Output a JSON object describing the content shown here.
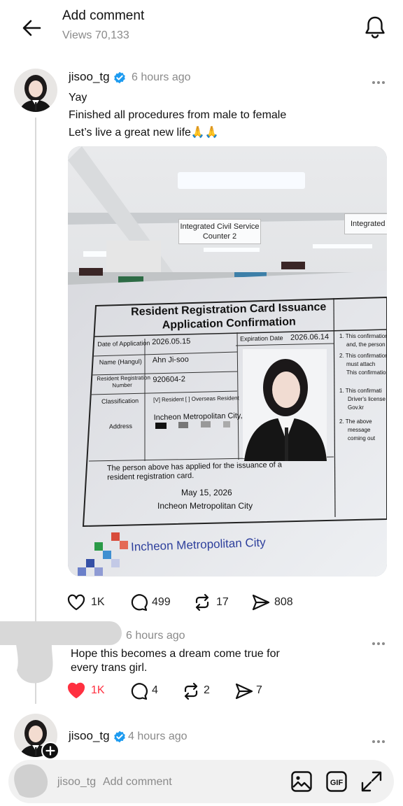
{
  "header": {
    "title": "Add comment",
    "views": "Views 70,133"
  },
  "post": {
    "username": "jisoo_tg",
    "time": "6 hours ago",
    "lines": [
      "Yay",
      "Finished all procedures from male to female",
      "Let’s live a great new life🙏🙏"
    ],
    "photo": {
      "sign_1": "Integrated Civil Service",
      "sign_1b": "Counter 2",
      "sign_2": "Integrated",
      "doc_title_1": "Resident Registration Card Issuance",
      "doc_title_2": "Application Confirmation",
      "date_label": "Date of Application",
      "date_value": "2026.05.15",
      "exp_label": "Expiration Date",
      "exp_value": "2026.06.14",
      "name_label": "Name (Hangul)",
      "name_value": "Ahn Ji-soo",
      "rrn_label_1": "Resident Registration",
      "rrn_label_2": "Number",
      "rrn_value": "920604-2",
      "class_label": "Classification",
      "class_value": "[V] Resident  [  ] Overseas Resident",
      "addr_label": "Address",
      "addr_value": "Incheon Metropolitan City,",
      "side_1": "1. This confirmation",
      "side_1b": "and, the person",
      "side_2": "2. This confirmation",
      "side_2b": "must attach",
      "side_2c": "This confirmation",
      "side_3": "1. This confirmati",
      "side_3b": "Driver's license",
      "side_3c": "Gov.kr",
      "side_4": "2. The above",
      "side_4b": "message",
      "side_4c": "coming out",
      "statement_1": "The person above has applied for the issuance of a",
      "statement_2": "resident registration card.",
      "issue_date": "May 15, 2026",
      "issuer": "Incheon Metropolitan City",
      "logo_text": "Incheon Metropolitan City"
    },
    "actions": {
      "likes": "1K",
      "comments": "499",
      "reposts": "17",
      "shares": "808"
    }
  },
  "reply": {
    "time": "6 hours ago",
    "lines": [
      "Hope this becomes a dream come true for",
      "every trans girl."
    ],
    "actions": {
      "likes": "1K",
      "comments": "4",
      "reposts": "2",
      "shares": "7"
    }
  },
  "composer": {
    "username": "jisoo_tg",
    "time": "4 hours ago"
  },
  "input": {
    "username": "jisoo_tg",
    "placeholder": "Add comment"
  },
  "colors": {
    "verified": "#1d9bf0",
    "like_active": "#ff3040",
    "thread_line": "#d9d9d9"
  }
}
